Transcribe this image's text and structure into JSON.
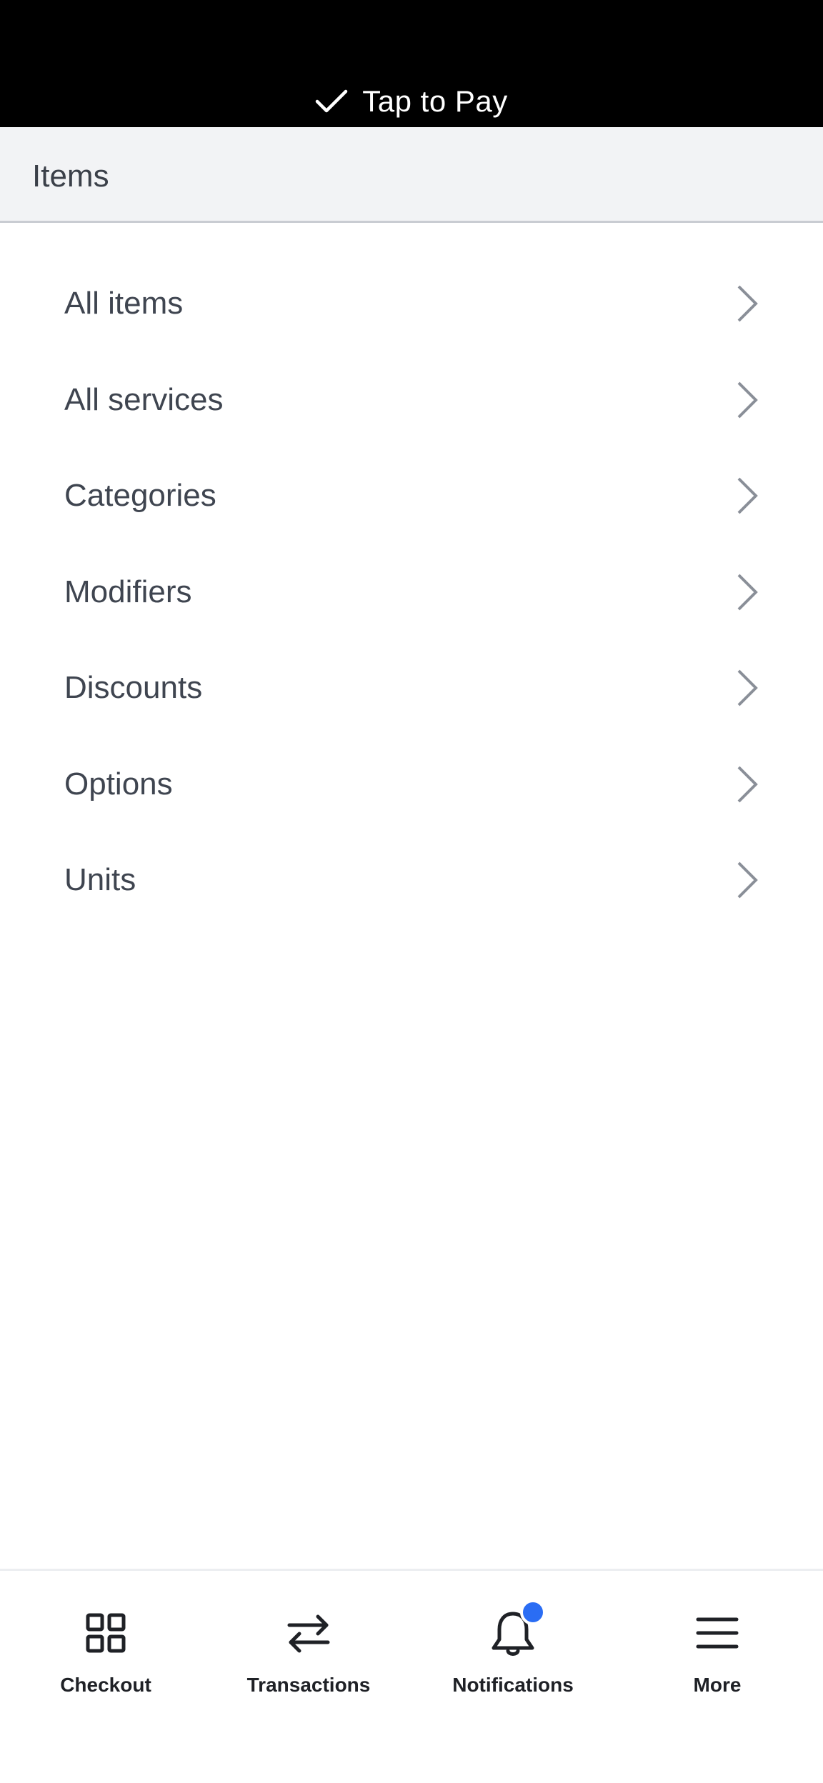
{
  "banner": {
    "text": "Tap to Pay",
    "icon": "check-icon"
  },
  "section": {
    "title": "Items"
  },
  "menu": {
    "items": [
      {
        "label": "All items"
      },
      {
        "label": "All services"
      },
      {
        "label": "Categories"
      },
      {
        "label": "Modifiers"
      },
      {
        "label": "Discounts"
      },
      {
        "label": "Options"
      },
      {
        "label": "Units"
      }
    ]
  },
  "bottom_nav": {
    "items": [
      {
        "label": "Checkout",
        "icon": "grid-icon"
      },
      {
        "label": "Transactions",
        "icon": "swap-arrows-icon"
      },
      {
        "label": "Notifications",
        "icon": "bell-icon",
        "has_unread_badge": true
      },
      {
        "label": "More",
        "icon": "hamburger-menu-icon"
      }
    ]
  },
  "colors": {
    "banner_bg": "#000000",
    "header_bg": "#f2f3f5",
    "badge": "#2a6df4",
    "chevron": "#8a8f98"
  }
}
